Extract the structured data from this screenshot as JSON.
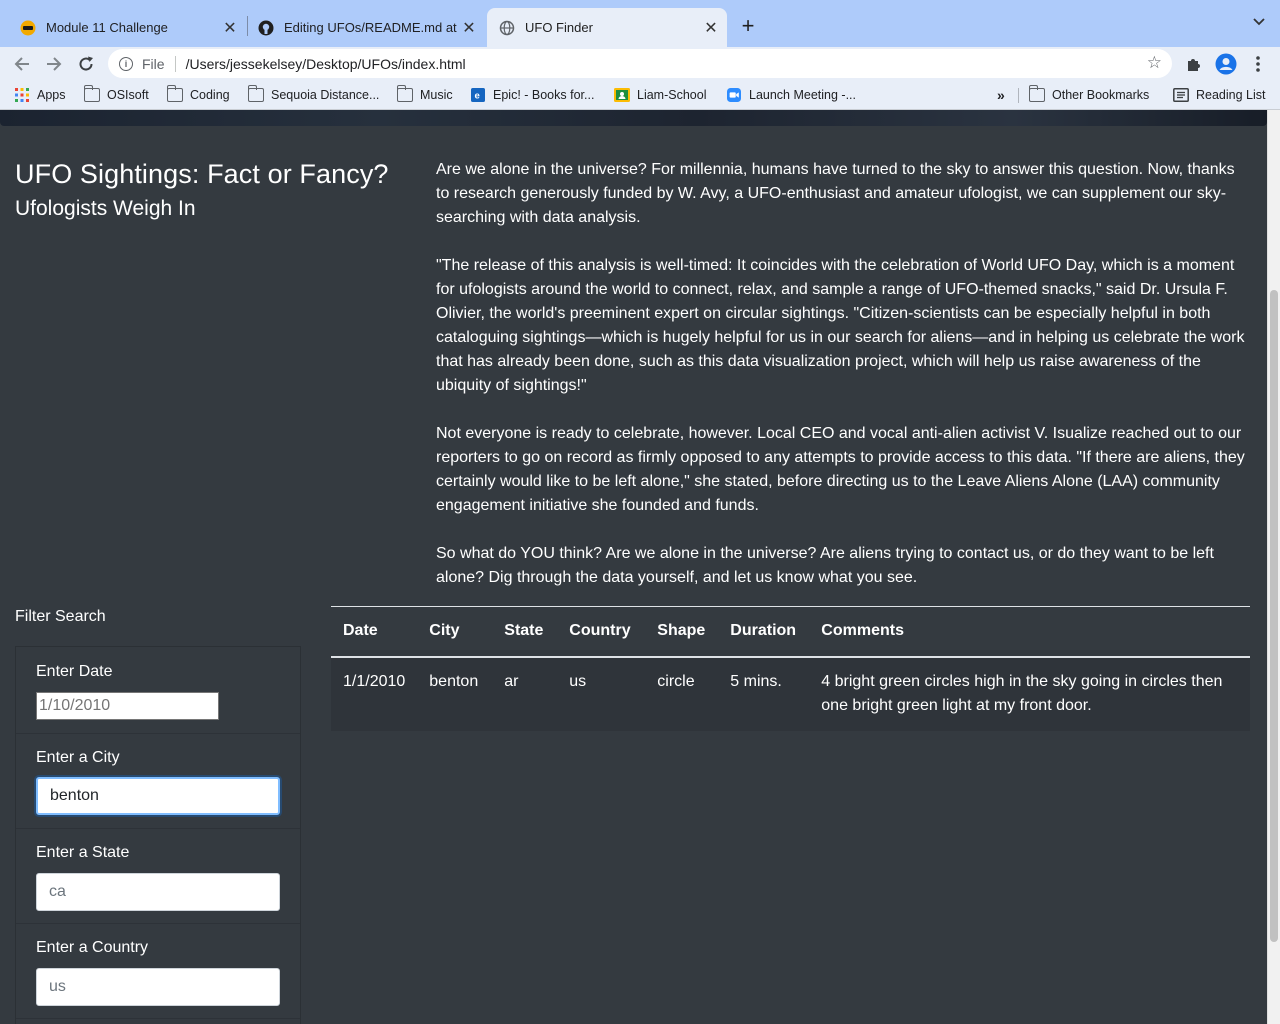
{
  "browser": {
    "tabs": [
      {
        "title": "Module 11 Challenge",
        "icon": "bootcamp-favicon",
        "active": false
      },
      {
        "title": "Editing UFOs/README.md at m",
        "icon": "github-icon",
        "active": false
      },
      {
        "title": "UFO Finder",
        "icon": "globe-icon",
        "active": true
      }
    ],
    "address": {
      "scheme": "File",
      "url": "/Users/jessekelsey/Desktop/UFOs/index.html"
    },
    "bookmarks": [
      {
        "label": "Apps",
        "icon": "apps-grid-icon"
      },
      {
        "label": "OSIsoft",
        "icon": "folder-icon"
      },
      {
        "label": "Coding",
        "icon": "folder-icon"
      },
      {
        "label": "Sequoia Distance...",
        "icon": "folder-icon"
      },
      {
        "label": "Music",
        "icon": "folder-icon"
      },
      {
        "label": "Epic! - Books for...",
        "icon": "epic-favicon"
      },
      {
        "label": "Liam-School",
        "icon": "classroom-favicon"
      },
      {
        "label": "Launch Meeting -...",
        "icon": "zoom-favicon"
      }
    ],
    "bookmarks_overflow": "»",
    "other_bookmarks": "Other Bookmarks",
    "reading_list": "Reading List"
  },
  "page": {
    "title": "UFO Sightings: Fact or Fancy?",
    "subtitle": "Ufologists Weigh In",
    "article": [
      "Are we alone in the universe? For millennia, humans have turned to the sky to answer this question. Now, thanks to research generously funded by W. Avy, a UFO-enthusiast and amateur ufologist, we can supplement our sky-searching with data analysis.",
      "\"The release of this analysis is well-timed: It coincides with the celebration of World UFO Day, which is a moment for ufologists around the world to connect, relax, and sample a range of UFO-themed snacks,\" said Dr. Ursula F. Olivier, the world's preeminent expert on circular sightings. \"Citizen-scientists can be especially helpful in both cataloguing sightings—which is hugely helpful for us in our search for aliens—and in helping us celebrate the work that has already been done, such as this data visualization project, which will help us raise awareness of the ubiquity of sightings!\"",
      "Not everyone is ready to celebrate, however. Local CEO and vocal anti-alien activist V. Isualize reached out to our reporters to go on record as firmly opposed to any attempts to provide access to this data. \"If there are aliens, they certainly would like to be left alone,\" she stated, before directing us to the Leave Aliens Alone (LAA) community engagement initiative she founded and funds.",
      "So what do YOU think? Are we alone in the universe? Are aliens trying to contact us, or do they want to be left alone? Dig through the data yourself, and let us know what you see."
    ]
  },
  "filters": {
    "heading": "Filter Search",
    "date": {
      "label": "Enter Date",
      "value": "",
      "placeholder": "1/10/2010"
    },
    "city": {
      "label": "Enter a City",
      "value": "benton",
      "placeholder": ""
    },
    "state": {
      "label": "Enter a State",
      "value": "",
      "placeholder": "ca"
    },
    "country": {
      "label": "Enter a Country",
      "value": "",
      "placeholder": "us"
    }
  },
  "table": {
    "headers": [
      "Date",
      "City",
      "State",
      "Country",
      "Shape",
      "Duration",
      "Comments"
    ],
    "rows": [
      [
        "1/1/2010",
        "benton",
        "ar",
        "us",
        "circle",
        "5 mins.",
        "4 bright green circles high in the sky going in circles then one bright green light at my front door."
      ]
    ]
  }
}
